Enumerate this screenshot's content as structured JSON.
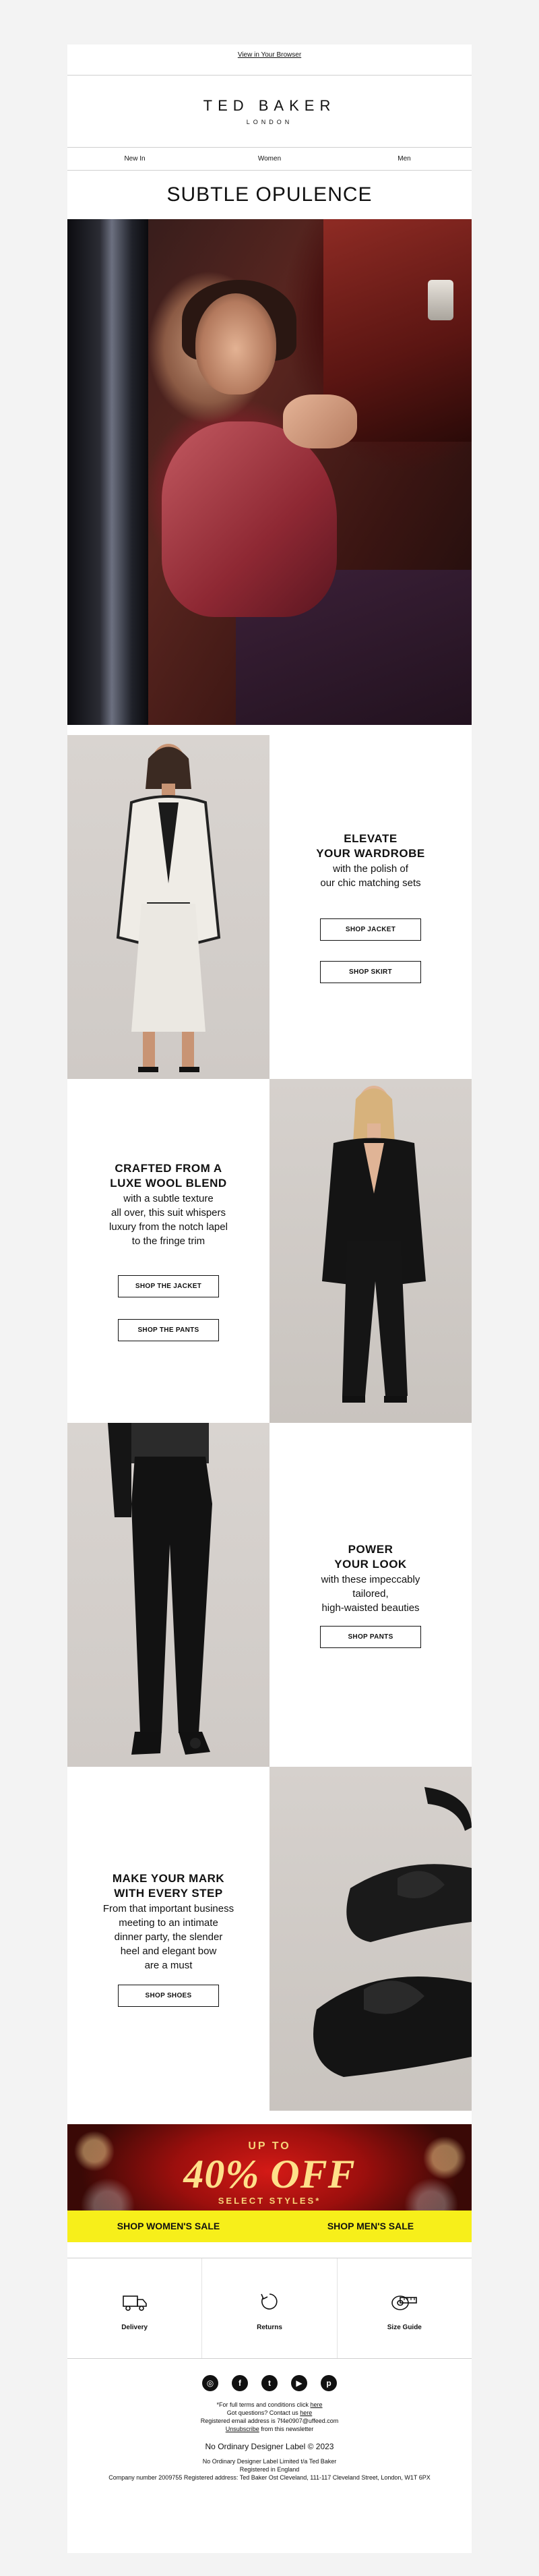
{
  "header": {
    "view_in_browser": "View in Your Browser",
    "brand": "TED BAKER",
    "brand_sub": "LONDON",
    "nav": [
      "New In",
      "Women",
      "Men"
    ]
  },
  "headline": "SUBTLE OPULENCE",
  "sections": [
    {
      "title_line1": "ELEVATE",
      "title_line2": "YOUR WARDROBE",
      "body": [
        "with the polish of",
        "our chic matching sets"
      ],
      "buttons": [
        "SHOP JACKET",
        "SHOP SKIRT"
      ]
    },
    {
      "title_line1": "CRAFTED FROM A",
      "title_line2": "LUXE WOOL BLEND",
      "body": [
        "with a subtle texture",
        "all over, this suit whispers",
        "luxury from the notch lapel",
        "to the fringe trim"
      ],
      "buttons": [
        "SHOP THE JACKET",
        "SHOP THE PANTS"
      ]
    },
    {
      "title_line1": "POWER",
      "title_line2": "YOUR LOOK",
      "body": [
        "with these impeccably",
        "tailored,",
        "high-waisted beauties"
      ],
      "buttons": [
        "SHOP PANTS"
      ]
    },
    {
      "title_line1": "MAKE YOUR MARK",
      "title_line2": "WITH EVERY STEP",
      "body": [
        "From that important business",
        "meeting to an intimate",
        "dinner party, the slender",
        "heel and elegant bow",
        "are a must"
      ],
      "buttons": [
        "SHOP SHOES"
      ]
    }
  ],
  "promo": {
    "up_to": "UP TO",
    "percent": "40% OFF",
    "select": "SELECT STYLES*",
    "shop_women": "SHOP WOMEN'S SALE",
    "shop_men": "SHOP MEN'S SALE"
  },
  "services": [
    {
      "label": "Delivery",
      "icon": "truck-icon"
    },
    {
      "label": "Returns",
      "icon": "returns-icon"
    },
    {
      "label": "Size Guide",
      "icon": "tape-measure-icon"
    }
  ],
  "social": [
    "instagram-icon",
    "facebook-icon",
    "twitter-icon",
    "youtube-icon",
    "pinterest-icon"
  ],
  "footer": {
    "line1_pre": "*For full terms and conditions click ",
    "line1_link": "here",
    "line2_pre": "Got questions? Contact us ",
    "line2_link": "here",
    "line3": "Registered email address is 7f4e0907@uffeed.com",
    "line4_link": "Unsubscribe",
    "line4_post": " from this newsletter",
    "copyright": "No Ordinary Designer Label © 2023",
    "legal1": "No Ordinary Designer Label Limited t/a Ted Baker",
    "legal2": "Registered in England",
    "legal3": "Company number 2009755  Registered address: Ted Baker Ost Cleveland, 111-117 Cleveland Street, London, W1T 6PX"
  }
}
